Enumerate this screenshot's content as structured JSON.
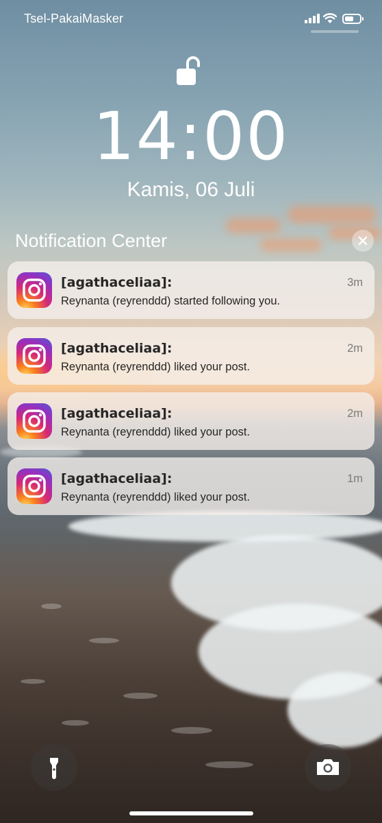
{
  "status_bar": {
    "carrier": "Tsel-PakaiMasker",
    "icons": [
      "signal-icon",
      "wifi-icon",
      "battery-icon"
    ]
  },
  "lock_screen": {
    "lock_icon": "unlocked-padlock-icon",
    "time": "14:00",
    "date": "Kamis, 06 Juli"
  },
  "notification_center": {
    "title": "Notification Center",
    "clear_icon": "close-icon",
    "notifications": [
      {
        "app_icon": "instagram-icon",
        "sender": "[agathaceliaa]:",
        "message": "Reynanta (reyrenddd) started following you.",
        "time": "3m"
      },
      {
        "app_icon": "instagram-icon",
        "sender": "[agathaceliaa]:",
        "message": "Reynanta (reyrenddd) liked your post.",
        "time": "2m"
      },
      {
        "app_icon": "instagram-icon",
        "sender": "[agathaceliaa]:",
        "message": "Reynanta (reyrenddd) liked your post.",
        "time": "2m"
      },
      {
        "app_icon": "instagram-icon",
        "sender": "[agathaceliaa]:",
        "message": "Reynanta (reyrenddd) liked your post.",
        "time": "1m"
      }
    ]
  },
  "bottom": {
    "left_button_icon": "flashlight-icon",
    "right_button_icon": "camera-icon"
  }
}
